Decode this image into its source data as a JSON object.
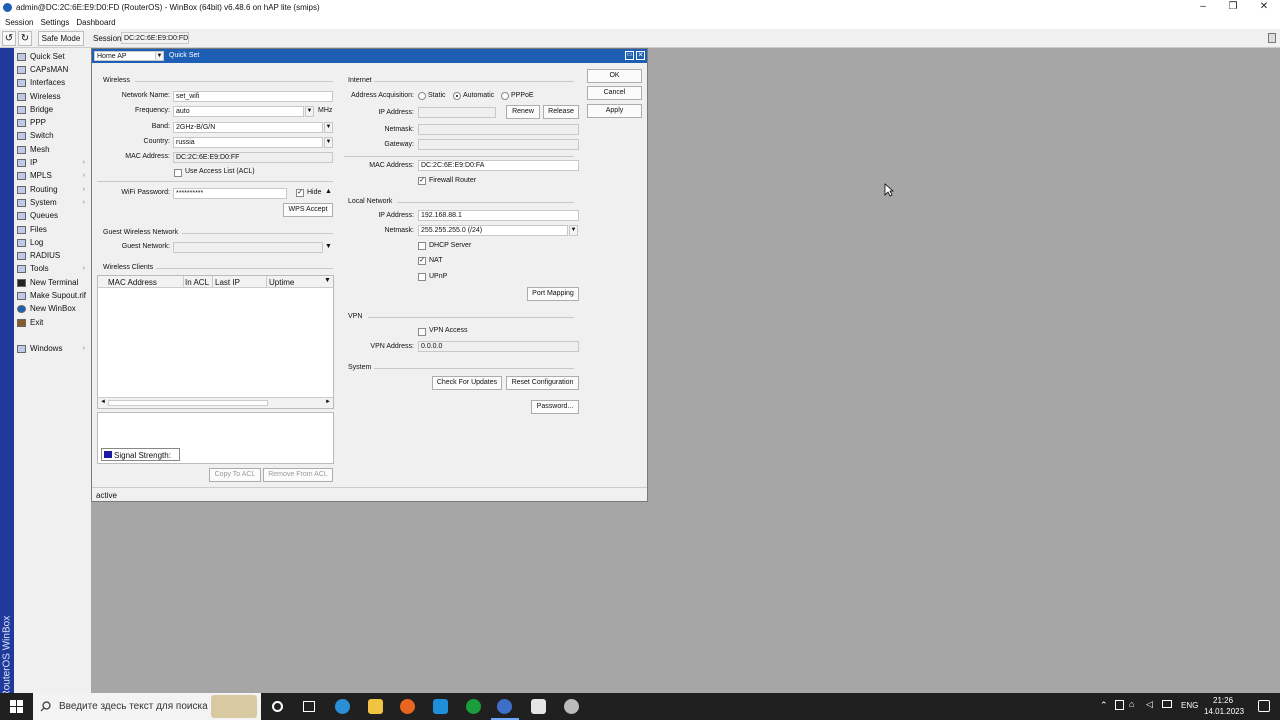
{
  "window": {
    "title": "admin@DC:2C:6E:E9:D0:FD (RouterOS) - WinBox (64bit) v6.48.6 on hAP lite (smips)"
  },
  "menubar": [
    "Session",
    "Settings",
    "Dashboard"
  ],
  "toolbar": {
    "undo": "↺",
    "redo": "↻",
    "safe_mode": "Safe Mode",
    "session_label": "Session:",
    "session_value": "DC:2C:6E:E9:D0:FD"
  },
  "brand": "RouterOS WinBox",
  "sidebar": [
    {
      "label": "Quick Set",
      "arrow": ""
    },
    {
      "label": "CAPsMAN",
      "arrow": ""
    },
    {
      "label": "Interfaces",
      "arrow": ""
    },
    {
      "label": "Wireless",
      "arrow": ""
    },
    {
      "label": "Bridge",
      "arrow": ""
    },
    {
      "label": "PPP",
      "arrow": ""
    },
    {
      "label": "Switch",
      "arrow": ""
    },
    {
      "label": "Mesh",
      "arrow": ""
    },
    {
      "label": "IP",
      "arrow": "›"
    },
    {
      "label": "MPLS",
      "arrow": "›"
    },
    {
      "label": "Routing",
      "arrow": "›"
    },
    {
      "label": "System",
      "arrow": "›"
    },
    {
      "label": "Queues",
      "arrow": ""
    },
    {
      "label": "Files",
      "arrow": ""
    },
    {
      "label": "Log",
      "arrow": ""
    },
    {
      "label": "RADIUS",
      "arrow": ""
    },
    {
      "label": "Tools",
      "arrow": "›"
    },
    {
      "label": "New Terminal",
      "arrow": ""
    },
    {
      "label": "Make Supout.rif",
      "arrow": ""
    },
    {
      "label": "New WinBox",
      "arrow": ""
    },
    {
      "label": "Exit",
      "arrow": ""
    },
    {
      "label": "Windows",
      "arrow": "›"
    }
  ],
  "dialog": {
    "mode": "Home AP",
    "title": "Quick Set",
    "status": "active",
    "buttons": {
      "ok": "OK",
      "cancel": "Cancel",
      "apply": "Apply"
    },
    "wireless": {
      "section": "Wireless",
      "network_name_label": "Network Name:",
      "network_name": "set_wifi",
      "frequency_label": "Frequency:",
      "frequency": "auto",
      "frequency_unit": "MHz",
      "band_label": "Band:",
      "band": "2GHz-B/G/N",
      "country_label": "Country:",
      "country": "russia",
      "mac_label": "MAC Address:",
      "mac": "DC:2C:6E:E9:D0:FF",
      "acl_label": "Use Access List (ACL)",
      "wifi_password_label": "WiFi Password:",
      "wifi_password": "**********",
      "hide_label": "Hide",
      "wps_button": "WPS Accept"
    },
    "guest": {
      "section": "Guest Wireless Network",
      "label": "Guest Network:"
    },
    "clients": {
      "section": "Wireless Clients",
      "columns": [
        "MAC Address",
        "In ACL",
        "Last IP",
        "Uptime"
      ],
      "signal_label": "Signal Strength:",
      "copy_button": "Copy To ACL",
      "remove_button": "Remove From ACL"
    },
    "internet": {
      "section": "Internet",
      "acquisition_label": "Address Acquisition:",
      "options": [
        "Static",
        "Automatic",
        "PPPoE"
      ],
      "ip_label": "IP Address:",
      "renew": "Renew",
      "release": "Release",
      "netmask_label": "Netmask:",
      "gateway_label": "Gateway:",
      "mac_label": "MAC Address:",
      "mac": "DC:2C:6E:E9:D0:FA",
      "firewall_label": "Firewall Router"
    },
    "local": {
      "section": "Local Network",
      "ip_label": "IP Address:",
      "ip": "192.168.88.1",
      "netmask_label": "Netmask:",
      "netmask": "255.255.255.0 (/24)",
      "dhcp_label": "DHCP Server",
      "nat_label": "NAT",
      "upnp_label": "UPnP",
      "port_mapping": "Port Mapping"
    },
    "vpn": {
      "section": "VPN",
      "access_label": "VPN Access",
      "address_label": "VPN Address:",
      "address": "0.0.0.0"
    },
    "system": {
      "section": "System",
      "check_updates": "Check For Updates",
      "reset": "Reset Configuration",
      "password": "Password..."
    }
  },
  "taskbar": {
    "search_placeholder": "Введите здесь текст для поиска",
    "lang": "ENG",
    "time": "21:26",
    "date": "14.01.2023"
  }
}
